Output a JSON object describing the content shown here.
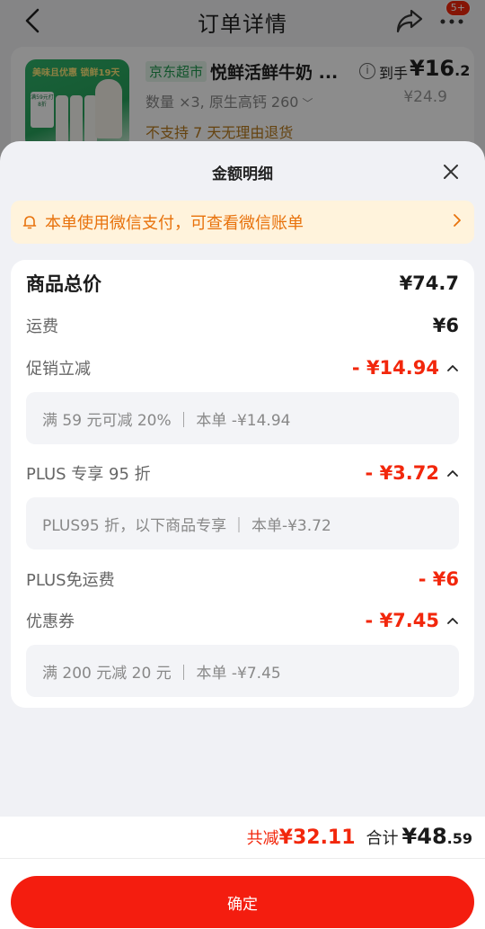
{
  "header": {
    "title": "订单详情",
    "badge": "5+"
  },
  "product": {
    "store_tag": "京东超市",
    "name": "悦鲜活鲜牛奶 ...",
    "spec": "数量 ×3, 原生高钙 260",
    "note": "不支持 7 天无理由退货",
    "to_hand_label": "到手",
    "to_hand_price_int": "¥16",
    "to_hand_price_dec": ".2",
    "orig_price": "¥24.9",
    "thumb_banner": "美味且优惠 锁鲜19天",
    "thumb_tag": "满59元打8折"
  },
  "sheet": {
    "title": "金额明细",
    "notice": "本单使用微信支付，可查看微信账单",
    "rows": [
      {
        "label": "商品总价",
        "value": "¥74.7"
      },
      {
        "label": "运费",
        "value": "¥6"
      },
      {
        "label": "促销立减",
        "value": "- ¥14.94",
        "detail": "满 59 元可减 20%  ｜ 本单 -¥14.94"
      },
      {
        "label": "PLUS 专享 95 折",
        "value": "- ¥3.72",
        "detail": "PLUS95 折，以下商品专享  ｜ 本单-¥3.72"
      },
      {
        "label": "PLUS免运费",
        "value": "- ¥6"
      },
      {
        "label": "优惠券",
        "value": "- ¥7.45",
        "detail": "满 200 元减 20 元  ｜ 本单 -¥7.45"
      }
    ]
  },
  "footer": {
    "off_label": "共减",
    "off_value": "¥32.11",
    "total_label": "合计",
    "total_int": "¥48",
    "total_dec": ".59",
    "confirm_label": "确定"
  },
  "colors": {
    "accent_red": "#f2270c",
    "notice_bg": "#fff3dc",
    "notice_text": "#e8720c"
  }
}
